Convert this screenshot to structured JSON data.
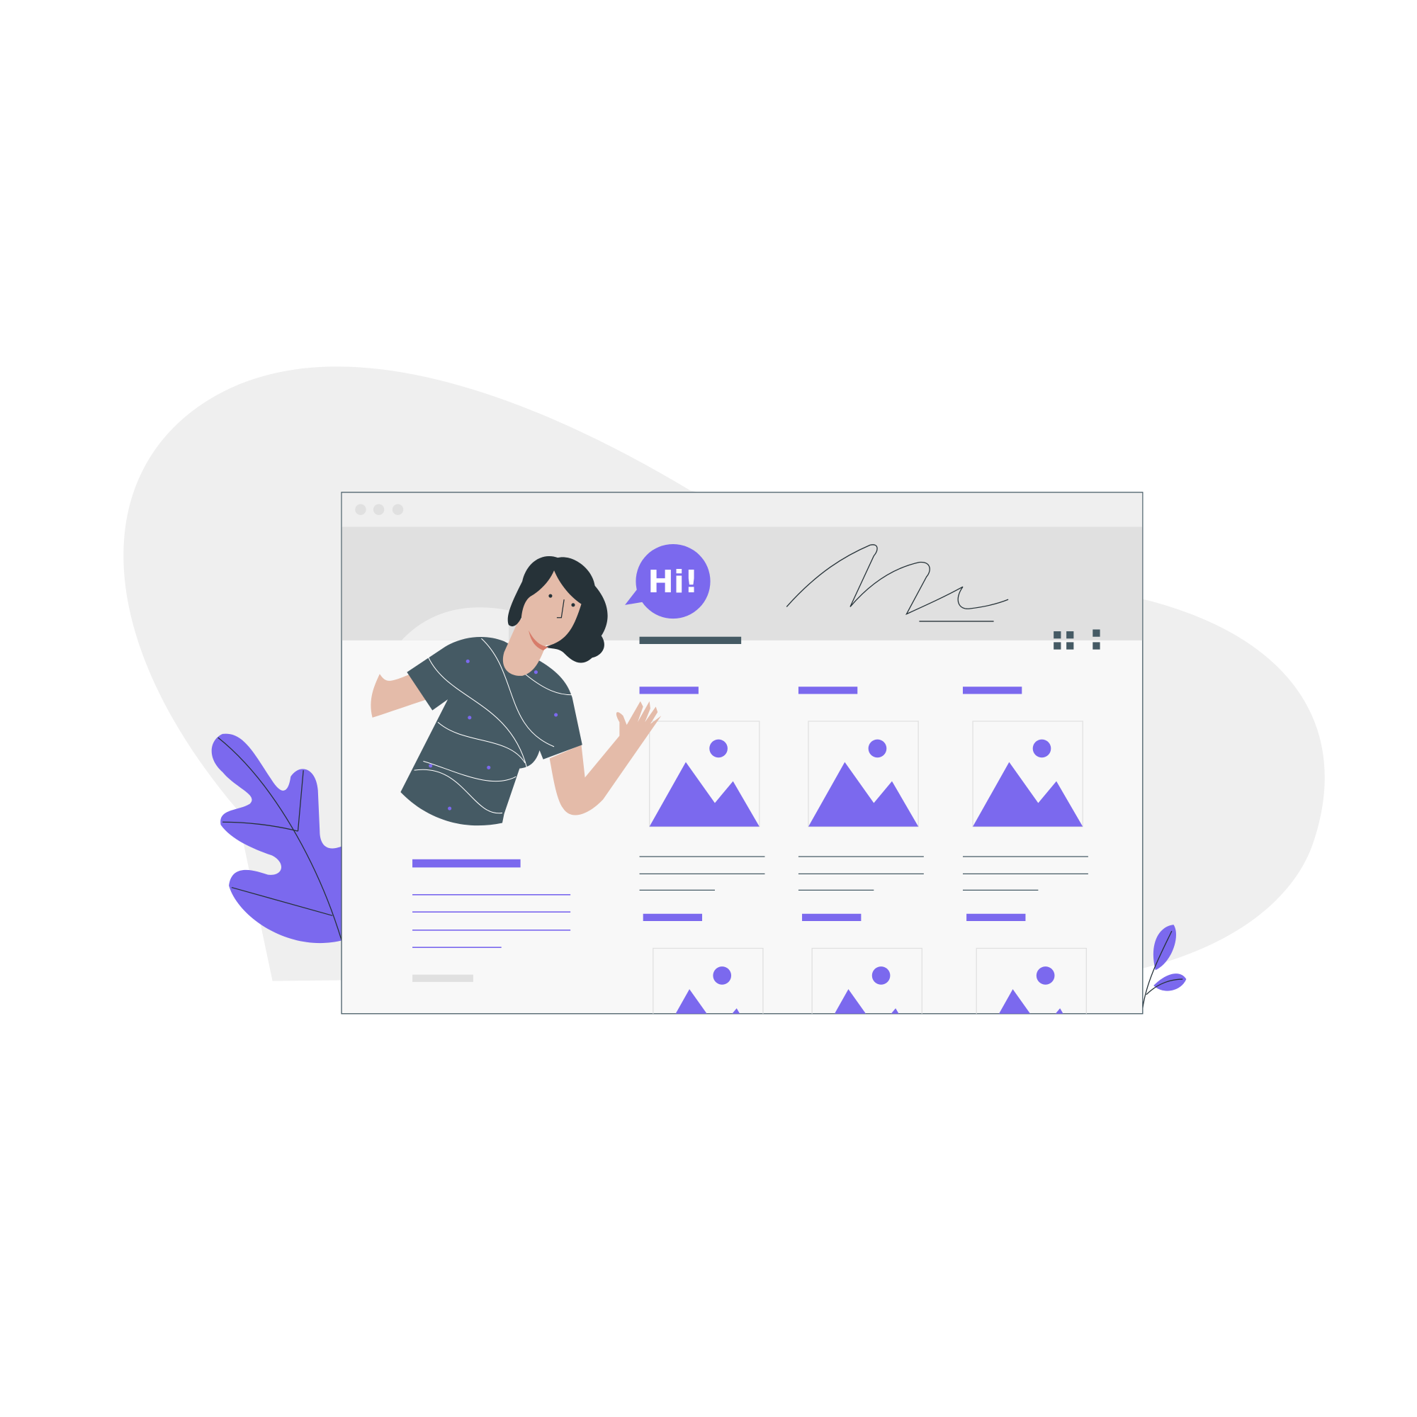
{
  "speech_bubble": {
    "text": "Hi!"
  },
  "colors": {
    "accent": "#7B69EE",
    "dark": "#455A64",
    "hair": "#263238",
    "skin": "#E4BBA9",
    "blob": "#EFEFEF",
    "window_bar": "#EFEFEF",
    "header": "#E0E0E0",
    "window_body": "#F8F8F8"
  },
  "window": {
    "dots": 3,
    "cards_visible": 6
  },
  "icons": [
    "grid-view-icon",
    "kebab-menu-icon",
    "image-placeholder-icon",
    "leaf-icon"
  ]
}
